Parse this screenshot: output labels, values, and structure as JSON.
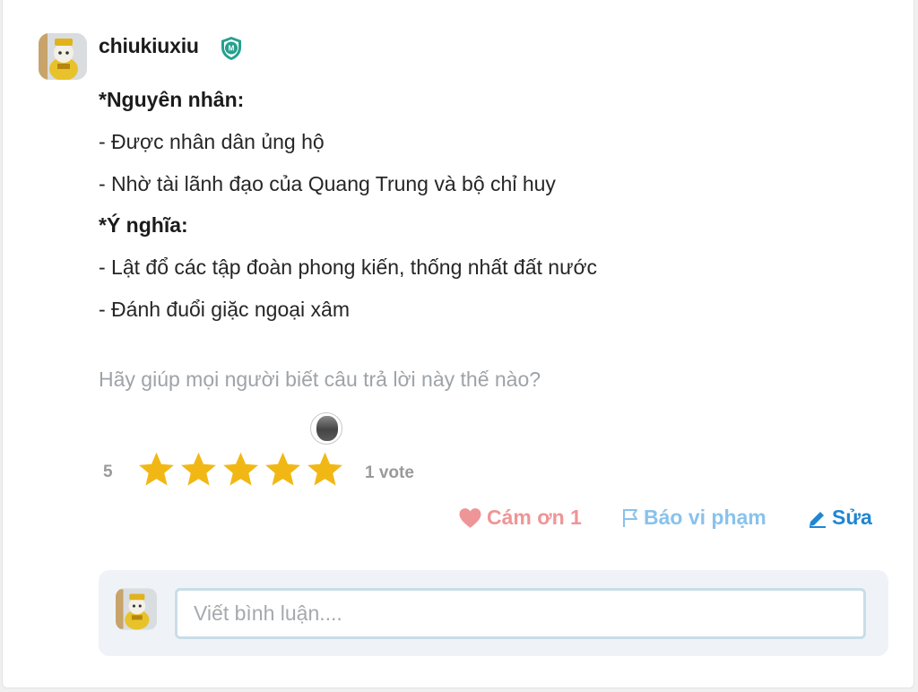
{
  "answer": {
    "author": "chiukiuxiu",
    "badge_icon": "moderator-shield-icon",
    "lines": [
      "*Nguyên nhân:",
      "- Được nhân dân ủng hộ",
      "- Nhờ tài lãnh đạo của Quang Trung và bộ chỉ huy",
      "*Ý nghĩa:",
      "- Lật đổ các tập đoàn phong kiến, thống nhất đất nước",
      "- Đánh đuổi giặc ngoại xâm"
    ]
  },
  "rating": {
    "prompt": "Hãy giúp mọi người biết câu trả lời này thế nào?",
    "score": "5",
    "stars_filled": 5,
    "stars_total": 5,
    "votes": "1 vote",
    "star_color": "#f1b815"
  },
  "actions": {
    "thanks": "Cám ơn 1",
    "report": "Báo vi phạm",
    "edit": "Sửa"
  },
  "comment": {
    "placeholder": "Viết bình luận...."
  },
  "colors": {
    "thanks": "#ee9597",
    "report": "#89c2ec",
    "edit": "#1f86d2",
    "badge": "#25a18e"
  }
}
